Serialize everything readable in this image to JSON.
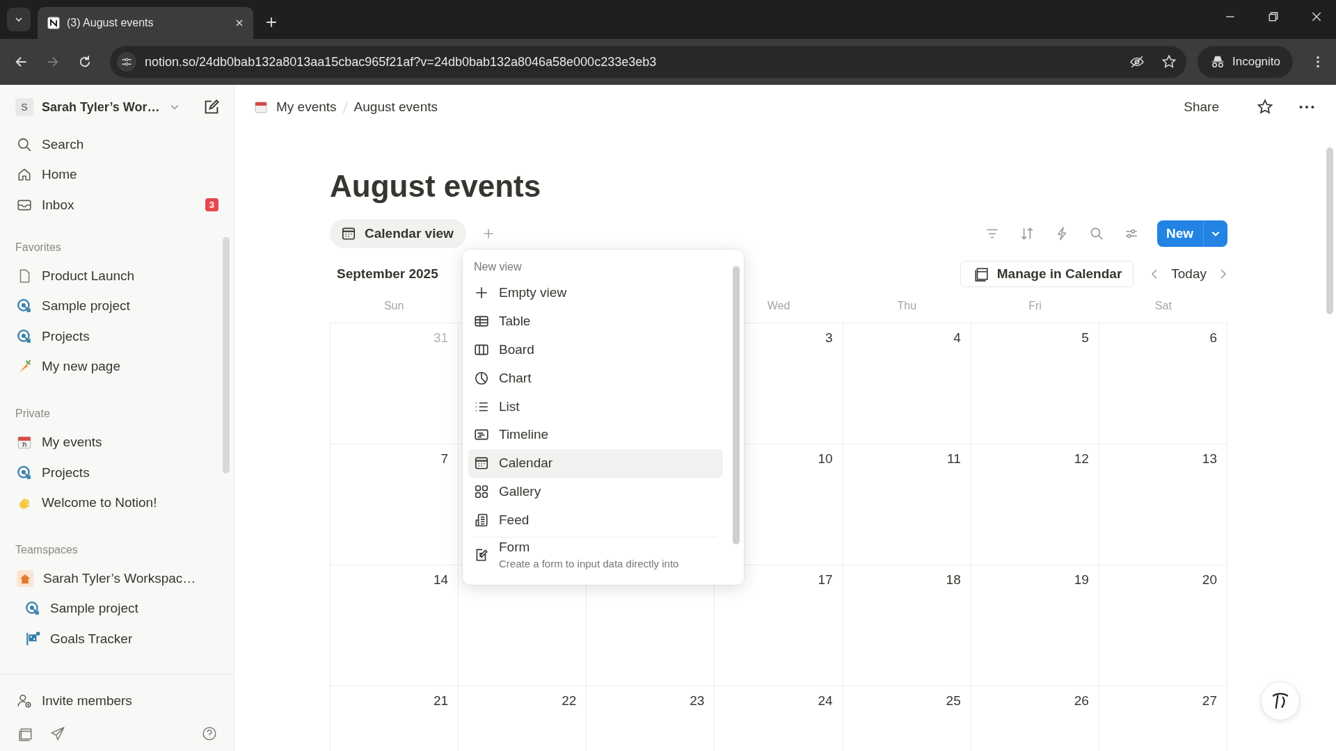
{
  "browser": {
    "tab_title": "(3) August events",
    "url": "notion.so/24db0bab132a8013aa15cbac965f21af?v=24db0bab132a8046a58e000c233e3eb3",
    "profile": "Incognito"
  },
  "sidebar": {
    "workspace_initial": "S",
    "workspace": "Sarah Tyler’s Wor…",
    "nav": [
      {
        "label": "Search",
        "kind": "search"
      },
      {
        "label": "Home",
        "kind": "home"
      },
      {
        "label": "Inbox",
        "kind": "inbox",
        "badge": "3"
      }
    ],
    "sections": [
      {
        "title": "Favorites",
        "items": [
          {
            "label": "Product Launch",
            "kind": "page"
          },
          {
            "label": "Sample project",
            "kind": "project"
          },
          {
            "label": "Projects",
            "kind": "project"
          },
          {
            "label": "My new page",
            "kind": "carrot"
          }
        ]
      },
      {
        "title": "Private",
        "items": [
          {
            "label": "My events",
            "kind": "calendar"
          },
          {
            "label": "Projects",
            "kind": "project"
          },
          {
            "label": "Welcome to Notion!",
            "kind": "sparkle"
          }
        ]
      },
      {
        "title": "Teamspaces",
        "items": [
          {
            "label": "Sarah Tyler’s Workspac…",
            "kind": "team",
            "children": [
              {
                "label": "Sample project",
                "kind": "project"
              },
              {
                "label": "Goals Tracker",
                "kind": "goals"
              }
            ]
          }
        ]
      }
    ],
    "footer": "Invite members"
  },
  "topbar": {
    "breadcrumb": [
      "My events",
      "August events"
    ],
    "share": "Share"
  },
  "page": {
    "title": "August events",
    "views": [
      {
        "label": "Calendar view",
        "selected": true
      }
    ],
    "new_button": "New",
    "calendar": {
      "month": "September 2025",
      "manage": "Manage in Calendar",
      "today": "Today",
      "weekdays": {
        "sun": "Sun",
        "wed": "Wed",
        "thu": "Thu",
        "fri": "Fri",
        "sat": "Sat"
      },
      "weeks": [
        {
          "sun": {
            "day": "31",
            "outside": true
          },
          "wed": {
            "day": "3",
            "outside": false
          },
          "thu": {
            "day": "4",
            "outside": false
          },
          "fri": {
            "day": "5",
            "outside": false
          },
          "sat": {
            "day": "6",
            "outside": false
          }
        },
        {
          "sun": {
            "day": "7",
            "outside": false
          },
          "wed": {
            "day": "10",
            "outside": false
          },
          "thu": {
            "day": "11",
            "outside": false
          },
          "fri": {
            "day": "12",
            "outside": false
          },
          "sat": {
            "day": "13",
            "outside": false
          }
        },
        {
          "sun": {
            "day": "14",
            "outside": false
          },
          "wed": {
            "day": "17",
            "outside": false
          },
          "thu": {
            "day": "18",
            "outside": false
          },
          "fri": {
            "day": "19",
            "outside": false
          },
          "sat": {
            "day": "20",
            "outside": false
          }
        },
        {
          "sun": {
            "day": "21",
            "outside": false
          },
          "mon": {
            "day": "22",
            "outside": false
          },
          "tue": {
            "day": "23",
            "outside": false
          },
          "wed": {
            "day": "24",
            "outside": false
          },
          "thu": {
            "day": "25",
            "outside": false
          },
          "fri": {
            "day": "26",
            "outside": false
          },
          "sat": {
            "day": "27",
            "outside": false
          }
        }
      ]
    }
  },
  "menu": {
    "title": "New view",
    "items": [
      {
        "label": "Empty view",
        "kind": "plus",
        "selected": false
      },
      {
        "label": "Table",
        "kind": "table",
        "selected": false
      },
      {
        "label": "Board",
        "kind": "board",
        "selected": false
      },
      {
        "label": "Chart",
        "kind": "chart",
        "selected": false
      },
      {
        "label": "List",
        "kind": "list",
        "selected": false
      },
      {
        "label": "Timeline",
        "kind": "timeline",
        "selected": false
      },
      {
        "label": "Calendar",
        "kind": "calendar",
        "selected": true
      },
      {
        "label": "Gallery",
        "kind": "gallery",
        "selected": false
      },
      {
        "label": "Feed",
        "kind": "feed",
        "selected": false
      },
      {
        "label": "Form",
        "kind": "form",
        "selected": false,
        "description": "Create a form to input data directly into"
      }
    ]
  }
}
